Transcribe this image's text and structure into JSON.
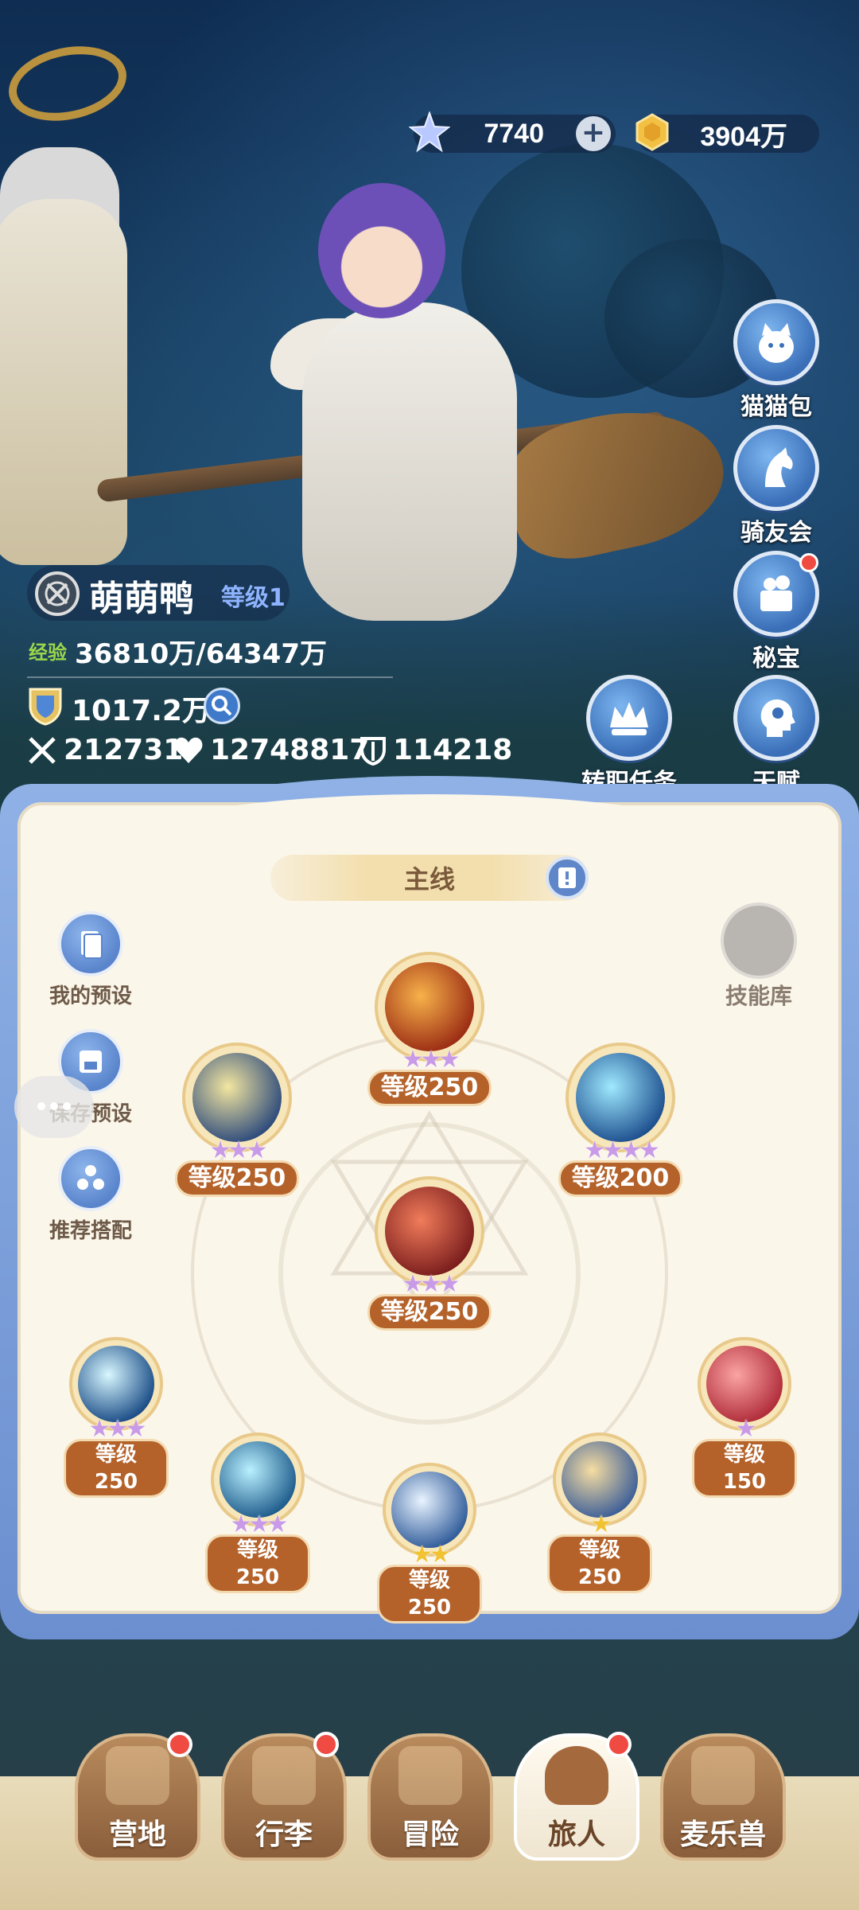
{
  "currency": {
    "gem_icon": "star-crystal-icon",
    "gem_value": "7740",
    "plus": "+",
    "gold_icon": "gold-coin-icon",
    "gold_value": "3904万"
  },
  "side_menu": [
    {
      "label": "猫猫包",
      "icon": "cat-bag-icon",
      "badge": false
    },
    {
      "label": "骑友会",
      "icon": "horse-icon",
      "badge": false
    },
    {
      "label": "秘宝",
      "icon": "treasure-icon",
      "badge": true
    },
    {
      "label": "转职任务",
      "icon": "crown-quest-icon",
      "badge": false
    },
    {
      "label": "天赋",
      "icon": "talent-head-icon",
      "badge": false
    }
  ],
  "player": {
    "name": "萌萌鸭",
    "level": "等级1",
    "exp_label": "经验",
    "exp_value": "36810万/64347万",
    "power": "1017.2万",
    "attack": "212731",
    "hp": "12748817",
    "defense": "114218"
  },
  "panel": {
    "tab": "主线",
    "tools": [
      {
        "label": "我的预设",
        "icon": "preset-card-icon"
      },
      {
        "label": "保存预设",
        "icon": "save-disk-icon"
      },
      {
        "label": "推荐搭配",
        "icon": "recommend-icon"
      }
    ],
    "skill_bank": "技能库",
    "skills": [
      {
        "level": "等级250",
        "stars": "★★★",
        "star_color": "purple",
        "colors": [
          "#f7b24a",
          "#9b2c14"
        ]
      },
      {
        "level": "等级250",
        "stars": "★★★",
        "star_color": "purple",
        "colors": [
          "#f3e6a0",
          "#2e4b7c"
        ]
      },
      {
        "level": "等级200",
        "stars": "★★★★",
        "star_color": "purple",
        "colors": [
          "#9fe9ff",
          "#1d4f8e"
        ]
      },
      {
        "level": "等级250",
        "stars": "★★★",
        "star_color": "purple",
        "colors": [
          "#f07c5a",
          "#7a1d1d"
        ]
      },
      {
        "level": "等级250",
        "stars": "★★★",
        "star_color": "purple",
        "colors": [
          "#d8f7ff",
          "#1a4c86"
        ]
      },
      {
        "level": "等级150",
        "stars": "★",
        "star_color": "gold",
        "colors": [
          "#fba4a4",
          "#b02c3a"
        ]
      },
      {
        "level": "等级250",
        "stars": "★★★",
        "star_color": "purple",
        "colors": [
          "#b9f1ff",
          "#1f5c8c"
        ]
      },
      {
        "level": "等级250",
        "stars": "★★",
        "star_color": "gold",
        "colors": [
          "#e9f4ff",
          "#315c9a"
        ]
      },
      {
        "level": "等级250",
        "stars": "★",
        "star_color": "gold",
        "colors": [
          "#f6dda2",
          "#3d5f98"
        ]
      }
    ]
  },
  "nav": [
    {
      "label": "营地",
      "icon": "castle-icon",
      "badge": true,
      "active": false
    },
    {
      "label": "行李",
      "icon": "luggage-icon",
      "badge": true,
      "active": false
    },
    {
      "label": "冒险",
      "icon": "crossed-swords-icon",
      "badge": false,
      "active": false
    },
    {
      "label": "旅人",
      "icon": "traveler-portrait-icon",
      "badge": true,
      "active": true
    },
    {
      "label": "麦乐兽",
      "icon": "pet-fox-icon",
      "badge": false,
      "active": false
    }
  ]
}
